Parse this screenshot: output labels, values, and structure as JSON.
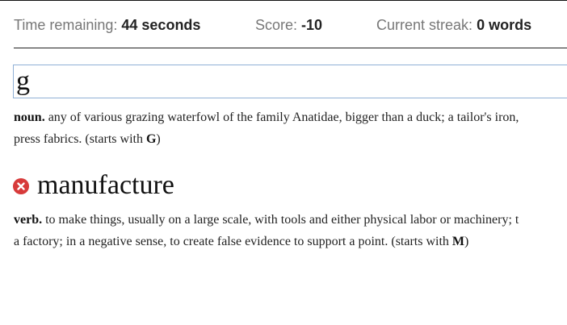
{
  "stats": {
    "time_label": "Time remaining:",
    "time_value": "44 seconds",
    "score_label": "Score:",
    "score_value": "-10",
    "streak_label": "Current streak:",
    "streak_value": "0 words"
  },
  "current": {
    "input_value": "g",
    "part_of_speech": "noun.",
    "definition_line1": "any of various grazing waterfowl of the family Anatidae, bigger than a duck; a tailor's iron,",
    "definition_line2": "press fabrics. (starts with ",
    "starts_with": "G",
    "close_paren": ")"
  },
  "missed": {
    "status_icon": "wrong-x-icon",
    "word": "manufacture",
    "part_of_speech": "verb.",
    "definition_line1": "to make things, usually on a large scale, with tools and either physical labor or machinery; t",
    "definition_line2": "a factory; in a negative sense, to create false evidence to support a point. (starts with ",
    "starts_with": "M",
    "close_paren": ")"
  },
  "colors": {
    "wrong": "#d73a3a",
    "input_border": "#8fb0d6",
    "stat_label": "#777777"
  }
}
